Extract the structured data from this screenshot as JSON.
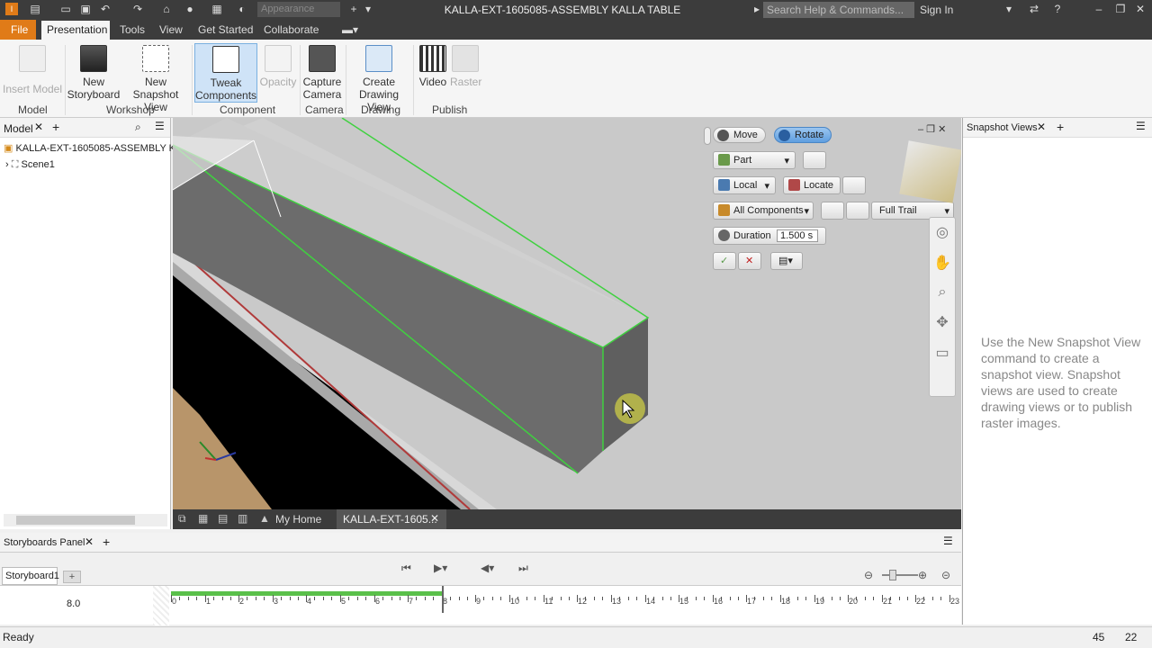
{
  "window": {
    "title": "KALLA-EXT-1605085-ASSEMBLY KALLA TABLE",
    "appearance_placeholder": "Appearance",
    "search_placeholder": "Search Help & Commands...",
    "sign_in": "Sign In"
  },
  "menu": {
    "file": "File",
    "tabs": [
      "Presentation",
      "Tools",
      "View",
      "Get Started",
      "Collaborate"
    ]
  },
  "ribbon": {
    "insert_model": "Insert Model",
    "new_storyboard": [
      "New",
      "Storyboard"
    ],
    "new_snapshot": [
      "New",
      "Snapshot View"
    ],
    "tweak": [
      "Tweak",
      "Components"
    ],
    "opacity": "Opacity",
    "capture": [
      "Capture",
      "Camera"
    ],
    "create_drawing": [
      "Create",
      "Drawing View"
    ],
    "video": "Video",
    "raster": "Raster",
    "groups": [
      "Model",
      "Workshop",
      "Component",
      "Camera",
      "Drawing",
      "Publish"
    ]
  },
  "model_panel": {
    "tab": "Model",
    "root": "KALLA-EXT-1605085-ASSEMBLY KALL",
    "scene": "Scene1"
  },
  "tweak_toolbar": {
    "move": "Move",
    "rotate": "Rotate",
    "part": "Part",
    "local": "Local",
    "locate": "Locate",
    "all_components": "All Components",
    "full_trail": "Full Trail",
    "duration_label": "Duration",
    "duration_value": "1.500 s"
  },
  "doc_tabs": {
    "home": "My Home",
    "doc": "KALLA-EXT-1605..."
  },
  "snapshot_panel": {
    "tab": "Snapshot Views",
    "hint": "Use the New Snapshot View command to create a snapshot view. Snapshot views are used to create drawing views or to publish raster images."
  },
  "storyboard": {
    "panel_tab": "Storyboards Panel",
    "tab": "Storyboard1",
    "time": "8.0",
    "ruler": [
      "0",
      "1",
      "2",
      "3",
      "4",
      "5",
      "6",
      "7",
      "8",
      "9",
      "10",
      "11",
      "12",
      "13",
      "14",
      "15",
      "16",
      "17",
      "18",
      "19",
      "20",
      "21",
      "22",
      "23"
    ],
    "progress_fraction": 0.348
  },
  "status": {
    "text": "Ready",
    "n1": "45",
    "n2": "22"
  },
  "colors": {
    "accent": "#e07b18",
    "highlight": "#5e9ee0",
    "edge": "#3fd13f"
  }
}
